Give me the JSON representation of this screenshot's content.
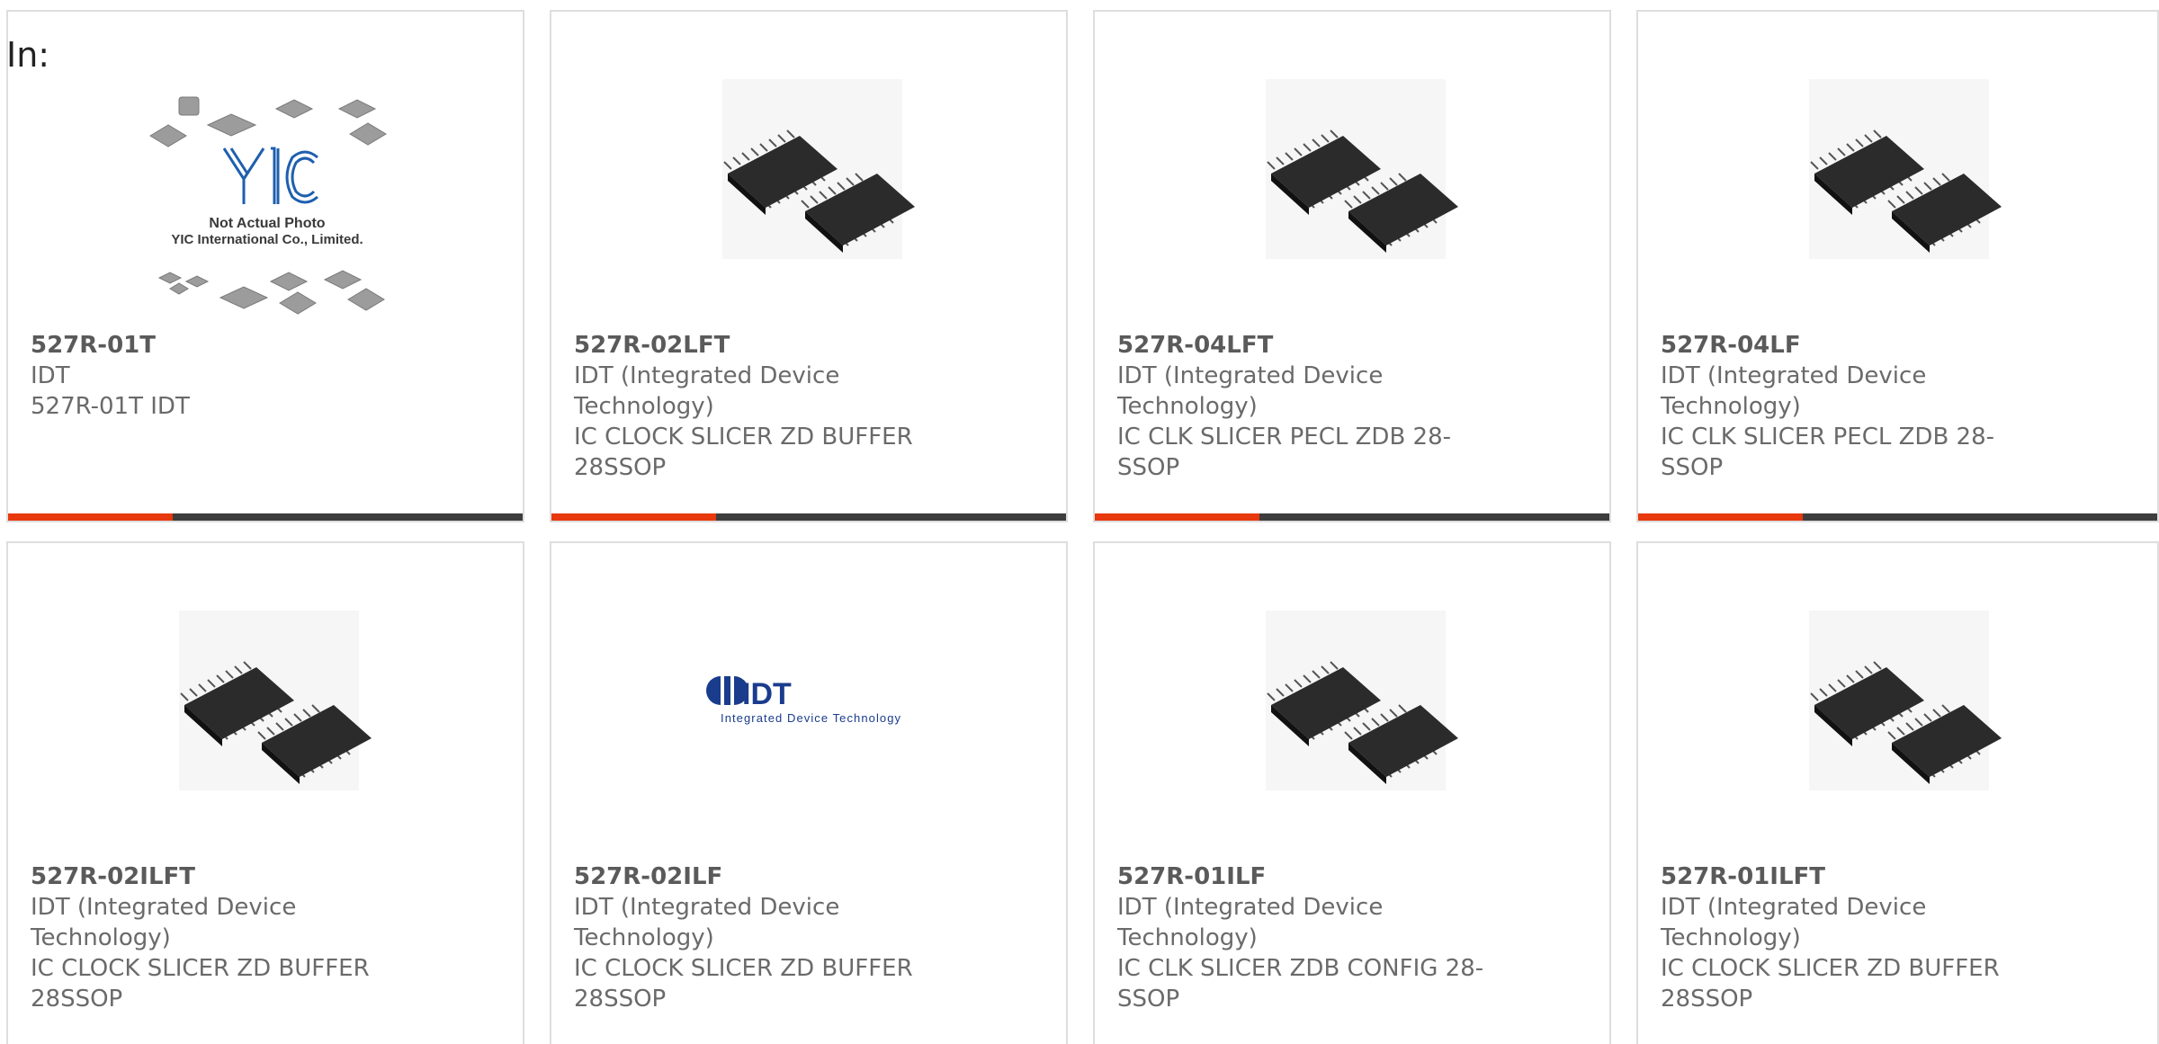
{
  "header": {
    "label": "In:"
  },
  "colors": {
    "accent": "#e8380d",
    "bar": "#3d3d3d"
  },
  "products": [
    {
      "part_number": "527R-01T",
      "manufacturer": "IDT",
      "description": "527R-01T IDT",
      "image": "placeholder-not-actual-photo",
      "placeholder_line1": "Not Actual Photo",
      "placeholder_line2": "YIC International Co., Limited.",
      "placeholder_logo": "YIC"
    },
    {
      "part_number": "527R-02LFT",
      "manufacturer": "IDT (Integrated Device Technology)",
      "description": "IC CLOCK SLICER ZD BUFFER 28SSOP",
      "image": "ssop-chip-photo"
    },
    {
      "part_number": "527R-04LFT",
      "manufacturer": "IDT (Integrated Device Technology)",
      "description": "IC CLK SLICER PECL ZDB 28-SSOP",
      "image": "ssop-chip-photo"
    },
    {
      "part_number": "527R-04LF",
      "manufacturer": "IDT (Integrated Device Technology)",
      "description": "IC CLK SLICER PECL ZDB 28-SSOP",
      "image": "ssop-chip-photo"
    },
    {
      "part_number": "527R-02ILFT",
      "manufacturer": "IDT (Integrated Device Technology)",
      "description": "IC CLOCK SLICER ZD BUFFER 28SSOP",
      "image": "ssop-chip-photo"
    },
    {
      "part_number": "527R-02ILF",
      "manufacturer": "IDT (Integrated Device Technology)",
      "description": "IC CLOCK SLICER ZD BUFFER 28SSOP",
      "image": "idt-logo",
      "logo_text": "IDT",
      "logo_subtitle": "Integrated Device Technology"
    },
    {
      "part_number": "527R-01ILF",
      "manufacturer": "IDT (Integrated Device Technology)",
      "description": "IC CLK SLICER ZDB CONFIG 28-SSOP",
      "image": "ssop-chip-photo"
    },
    {
      "part_number": "527R-01ILFT",
      "manufacturer": "IDT (Integrated Device Technology)",
      "description": "IC CLOCK SLICER ZD BUFFER 28SSOP",
      "image": "ssop-chip-photo"
    }
  ]
}
